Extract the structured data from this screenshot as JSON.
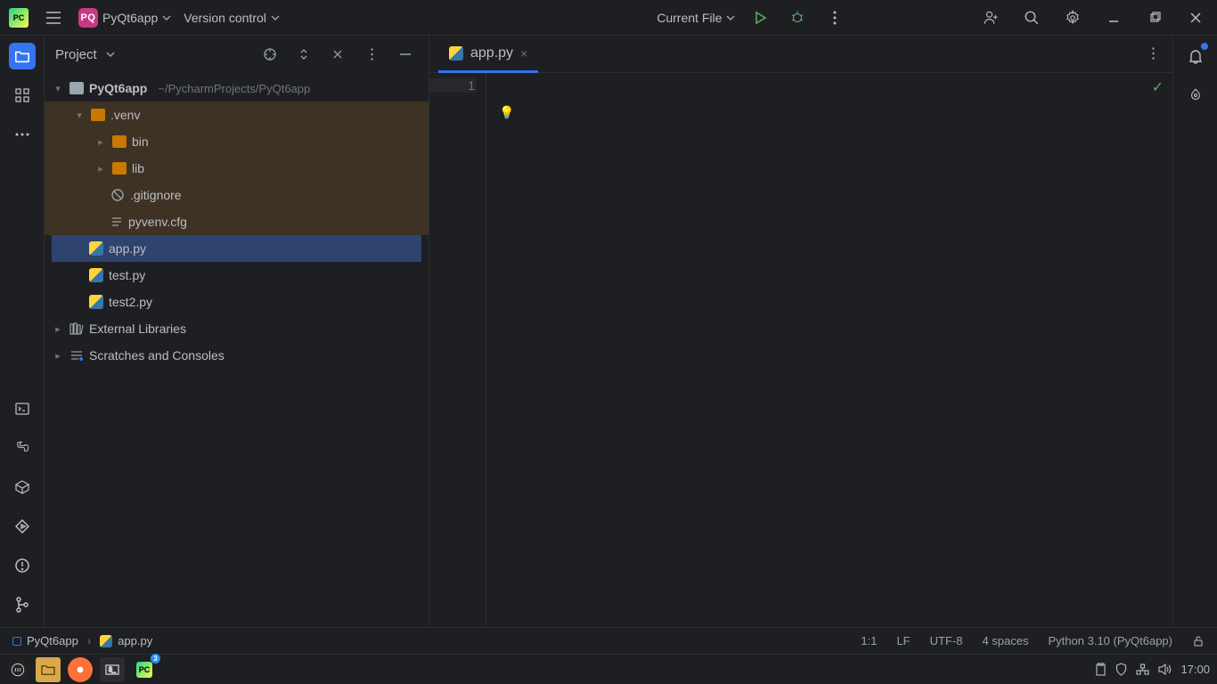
{
  "toolbar": {
    "project_badge": "PQ",
    "project_name": "PyQt6app",
    "vcs_label": "Version control",
    "run_target": "Current File"
  },
  "project_panel": {
    "title": "Project",
    "root": {
      "name": "PyQt6app",
      "path": "~/PycharmProjects/PyQt6app"
    },
    "venv": {
      "name": ".venv",
      "children": [
        {
          "name": "bin",
          "type": "dir"
        },
        {
          "name": "lib",
          "type": "dir"
        },
        {
          "name": ".gitignore",
          "type": "gitignore"
        },
        {
          "name": "pyvenv.cfg",
          "type": "cfg"
        }
      ]
    },
    "files": [
      {
        "name": "app.py",
        "selected": true
      },
      {
        "name": "test.py"
      },
      {
        "name": "test2.py"
      }
    ],
    "extra": [
      "External Libraries",
      "Scratches and Consoles"
    ]
  },
  "editor": {
    "tab": "app.py",
    "line_number": "1"
  },
  "nav": {
    "crumb_root": "PyQt6app",
    "crumb_file": "app.py"
  },
  "status": {
    "caret": "1:1",
    "eol": "LF",
    "encoding": "UTF-8",
    "indent": "4 spaces",
    "interpreter": "Python 3.10 (PyQt6app)"
  },
  "taskbar": {
    "clock": "17:00"
  }
}
